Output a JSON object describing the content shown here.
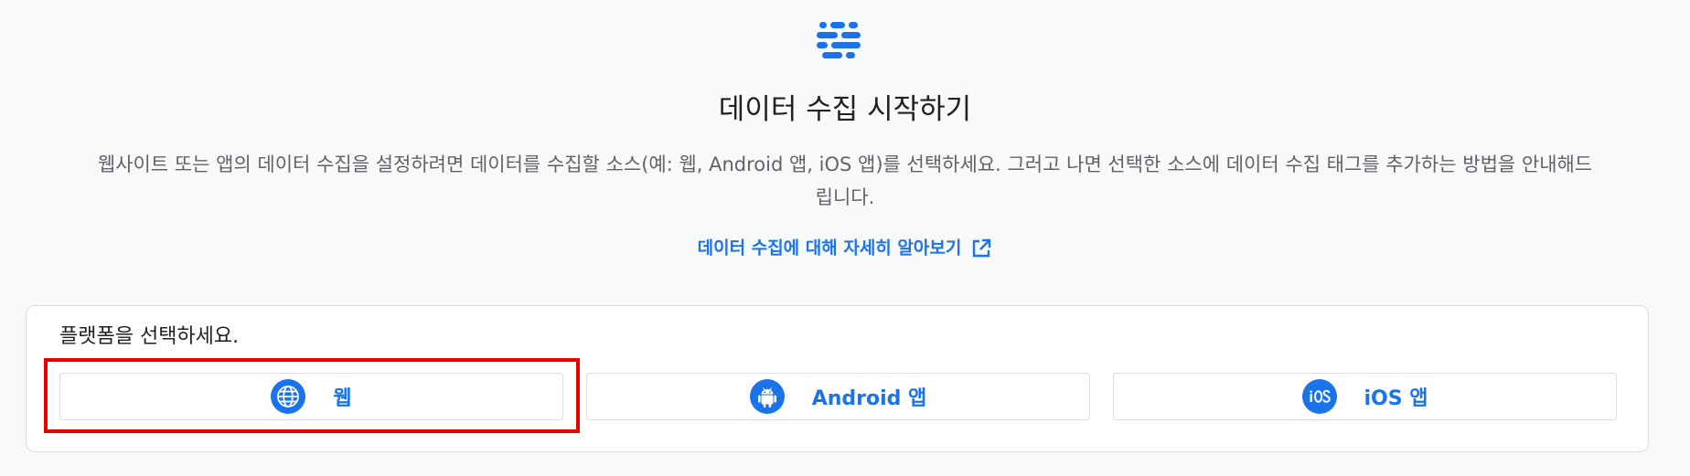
{
  "header": {
    "icon": "data-streams-icon",
    "title": "데이터 수집 시작하기",
    "description": "웹사이트 또는 앱의 데이터 수집을 설정하려면 데이터를 수집할 소스(예: 웹, Android 앱, iOS 앱)를 선택하세요. 그러고 나면 선택한 소스에 데이터 수집 태그를 추가하는 방법을 안내해드립니다.",
    "learn_more": "데이터 수집에 대해 자세히 알아보기",
    "learn_more_icon": "external-link-icon"
  },
  "platform_card": {
    "label": "플랫폼을 선택하세요.",
    "buttons": [
      {
        "label": "웹",
        "icon": "globe-icon"
      },
      {
        "label": "Android 앱",
        "icon": "android-icon"
      },
      {
        "label": "iOS 앱",
        "icon": "ios-icon"
      }
    ]
  },
  "colors": {
    "accent": "#1a73e8",
    "highlight": "#e60000"
  }
}
